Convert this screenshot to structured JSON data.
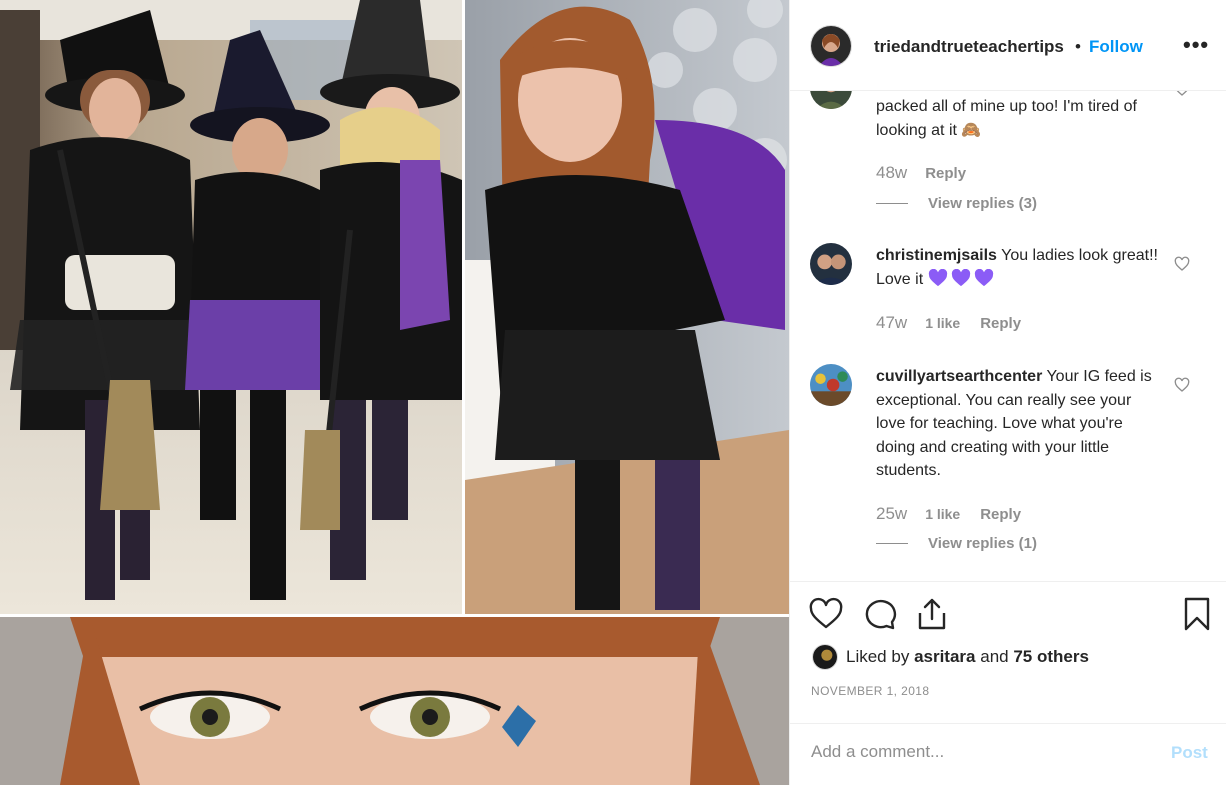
{
  "header": {
    "username": "triedandtrueteachertips",
    "separator": "•",
    "follow_label": "Follow",
    "more_label": "•••"
  },
  "comments": [
    {
      "username": "",
      "text": "packed all of mine up too! I'm tired of looking at it 🙈",
      "time": "48w",
      "likes": "",
      "reply_label": "Reply",
      "view_replies": "View replies (3)"
    },
    {
      "username": "christinemjsails",
      "text": "You ladies look great!! Love it",
      "time": "47w",
      "likes": "1 like",
      "reply_label": "Reply",
      "view_replies": ""
    },
    {
      "username": "cuvillyartsearthcenter",
      "text": "Your IG feed is exceptional. You can really see your love for teaching. Love what you're doing and creating with your little students.",
      "time": "25w",
      "likes": "1 like",
      "reply_label": "Reply",
      "view_replies": "View replies (1)"
    }
  ],
  "actions": {
    "icons": [
      "heart-icon",
      "comment-icon",
      "share-icon",
      "bookmark-icon"
    ],
    "liked_prefix": "Liked by",
    "liked_user": "asritara",
    "liked_and": "and",
    "liked_others": "75 others",
    "date": "NOVEMBER 1, 2018"
  },
  "add_comment": {
    "placeholder": "Add a comment...",
    "post_label": "Post"
  },
  "colors": {
    "link_blue": "#0095f6",
    "post_disabled": "#b2dffc",
    "muted": "#8e8e8e",
    "heart_purple": "#8b5cf6"
  }
}
